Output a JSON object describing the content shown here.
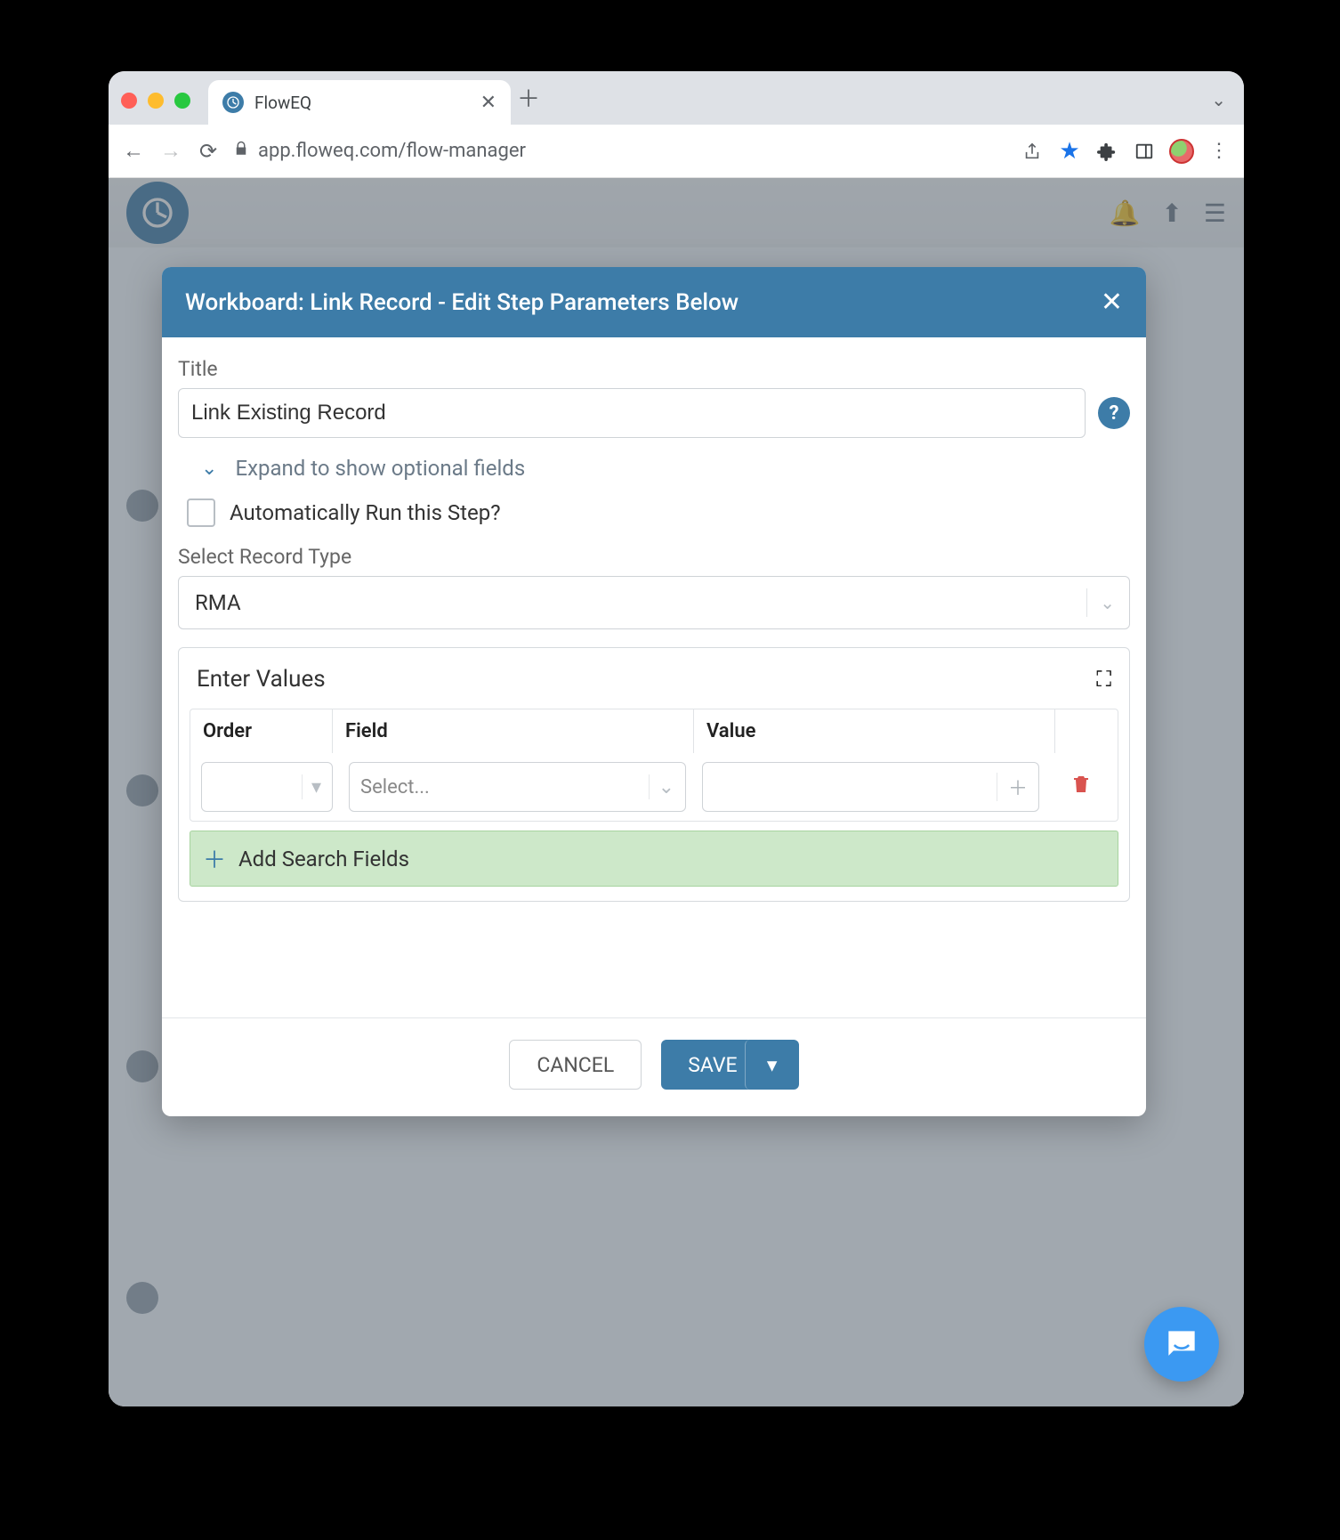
{
  "browser": {
    "tab_title": "FlowEQ",
    "url": "app.floweq.com/flow-manager"
  },
  "modal": {
    "header": "Workboard: Link Record - Edit Step Parameters Below",
    "title_label": "Title",
    "title_value": "Link Existing Record",
    "expand_text": "Expand to show optional fields",
    "auto_run_label": "Automatically Run this Step?",
    "record_type_label": "Select Record Type",
    "record_type_value": "RMA",
    "values_heading": "Enter Values",
    "columns": {
      "order": "Order",
      "field": "Field",
      "value": "Value"
    },
    "field_placeholder": "Select...",
    "add_fields_label": "Add Search Fields",
    "cancel_label": "CANCEL",
    "save_label": "SAVE"
  }
}
